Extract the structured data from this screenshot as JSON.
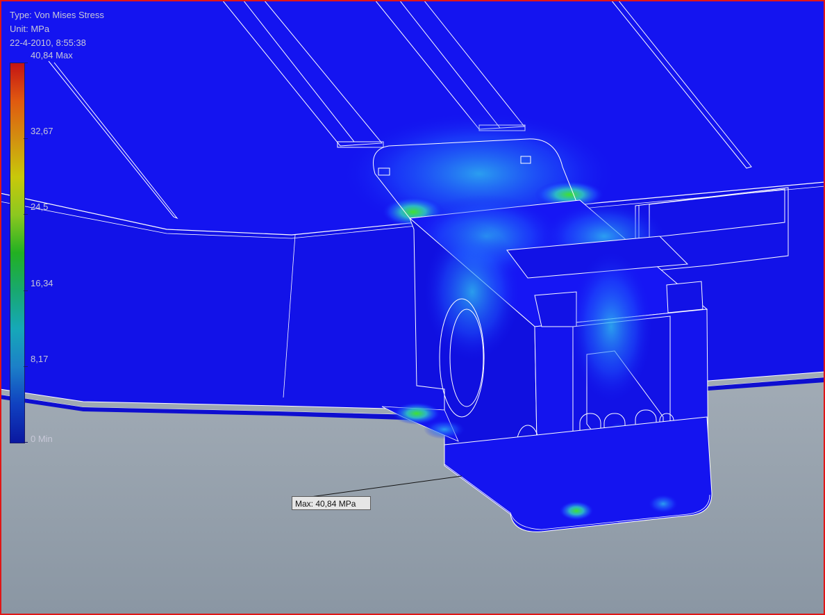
{
  "legend": {
    "type_line": "Type: Von Mises Stress",
    "unit_line": "Unit: MPa",
    "date_line": "22-4-2010, 8:55:38",
    "ticks": [
      "40,84 Max",
      "32,67",
      "24,5",
      "16,34",
      "8,17",
      "0 Min"
    ],
    "max_value": 40.84,
    "min_value": 0,
    "unit": "MPa",
    "colors": [
      "#c41414",
      "#d39010",
      "#c8c80a",
      "#22b022",
      "#16a8b8",
      "#0a18a0"
    ]
  },
  "probe": {
    "label": "Max: 40,84 MPa"
  },
  "model": {
    "base_color": "#1414f0",
    "outline_color": "#ffffff",
    "background_color": "#a2acb6",
    "frame_color": "#e01616"
  }
}
